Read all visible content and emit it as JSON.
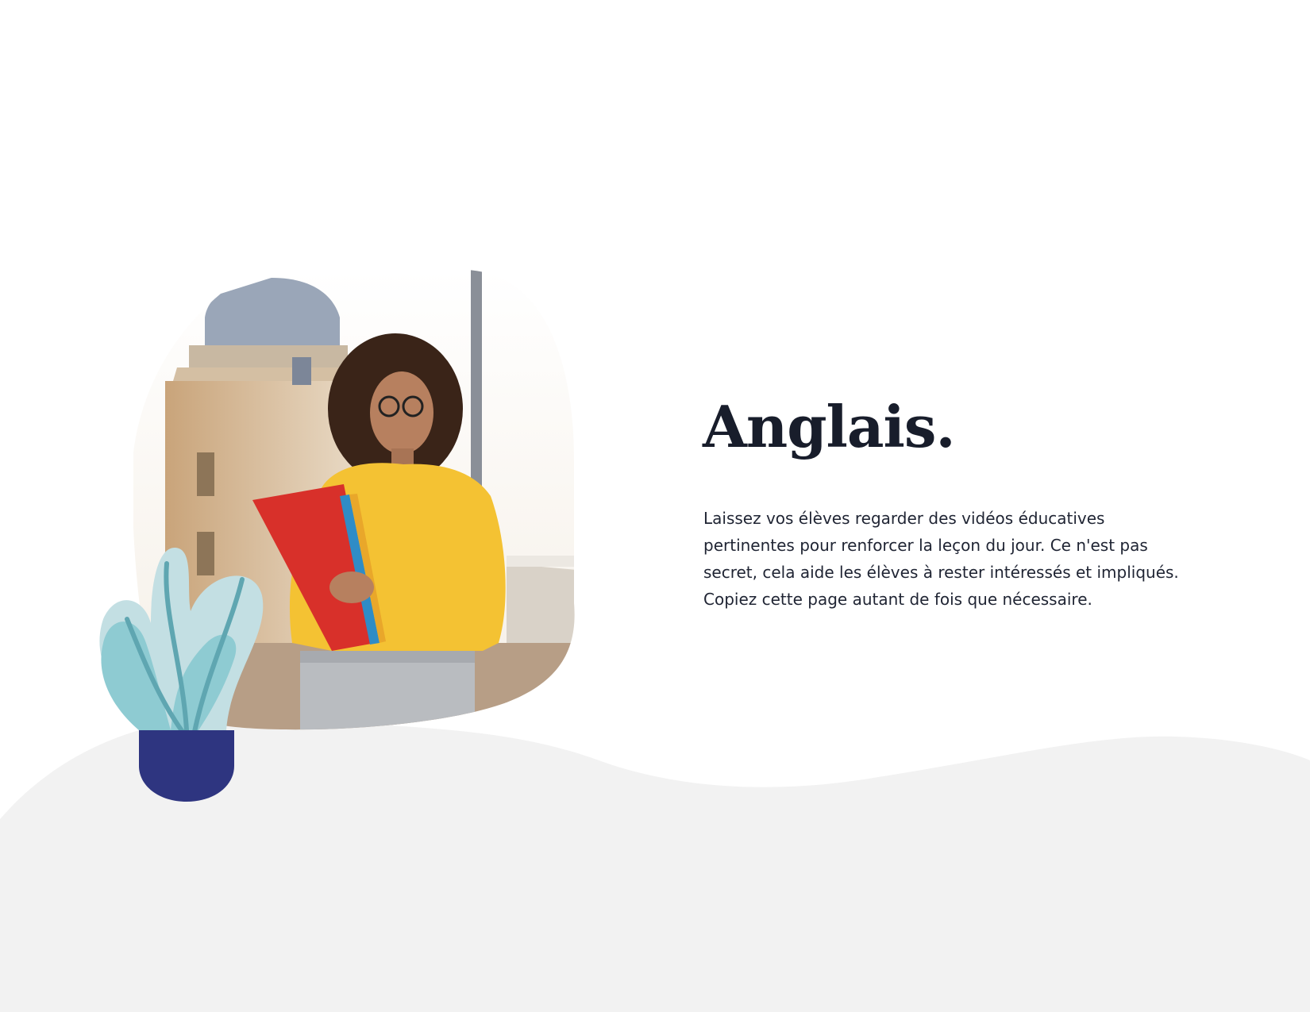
{
  "document": {
    "title": "Anglais.",
    "body": "Laissez vos élèves regarder des vidéos éducatives pertinentes pour renforcer la leçon du jour. Ce n'est pas secret, cela aide les élèves à rester intéressés et impliqués. Copiez cette page autant de fois que nécessaire."
  },
  "illustrations": {
    "photo": "student-photo",
    "plant": "potted-plant-icon"
  },
  "colors": {
    "background": "#ffffff",
    "wave": "#f2f2f2",
    "title": "#181d2b",
    "text": "#1f2433",
    "pot": "#2e3580",
    "leaf_light": "#c3dfe3",
    "leaf_mid": "#8ecbd2",
    "leaf_dark": "#5fa6b1",
    "shirt": "#f4c233",
    "binder": "#d8302a"
  }
}
